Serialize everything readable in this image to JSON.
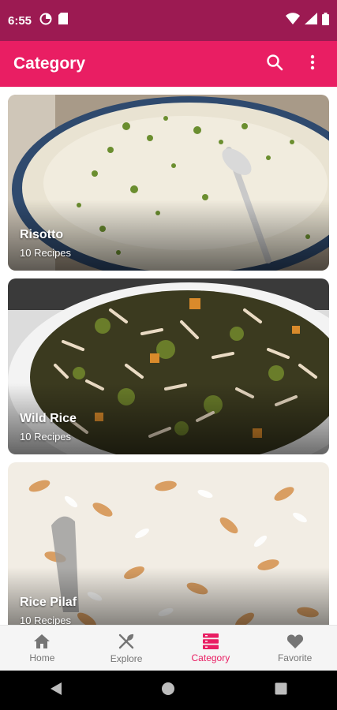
{
  "status_bar": {
    "time": "6:55",
    "left_icons": [
      "data-saver-icon",
      "sim-card-icon"
    ],
    "right_icons": [
      "wifi-icon",
      "signal-icon",
      "battery-icon"
    ]
  },
  "app_bar": {
    "title": "Category",
    "actions": [
      "search-icon",
      "more-vert-icon"
    ]
  },
  "categories": [
    {
      "title": "Risotto",
      "count": "10 Recipes"
    },
    {
      "title": "Wild Rice",
      "count": "10 Recipes"
    },
    {
      "title": "Rice Pilaf",
      "count": "10 Recipes"
    }
  ],
  "bottom_nav": {
    "items": [
      {
        "label": "Home",
        "icon": "home-icon",
        "active": false
      },
      {
        "label": "Explore",
        "icon": "fork-knife-icon",
        "active": false
      },
      {
        "label": "Category",
        "icon": "category-list-icon",
        "active": true
      },
      {
        "label": "Favorite",
        "icon": "heart-icon",
        "active": false
      }
    ]
  },
  "colors": {
    "status_bar": "#9c1a52",
    "app_bar": "#e91e63",
    "accent": "#e91e63",
    "nav_inactive": "#757575"
  }
}
